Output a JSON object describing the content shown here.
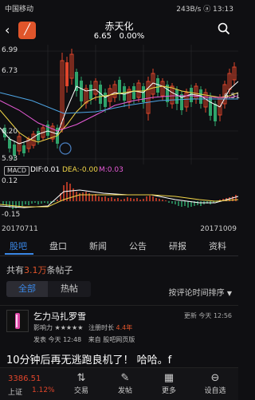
{
  "status": {
    "carrier": "中国移动",
    "right": "243B/s ⓐ 13:13"
  },
  "header": {
    "title": "赤天化",
    "price": "6.65",
    "change": "0.00%"
  },
  "chart_labels": {
    "y_top": "6.99",
    "y_mid1": "6.73",
    "y_mid2": "6.20",
    "y_low": "5.93",
    "last": "6.51"
  },
  "macd": {
    "label": "MACD",
    "dif": "DIF:0.01",
    "dea": "DEA:-0.00",
    "m": "M:0.03",
    "y_top": "0.12",
    "y_bot": "-0.15"
  },
  "dates": {
    "start": "20170711",
    "end": "20171009"
  },
  "tabs": [
    "股吧",
    "盘口",
    "新闻",
    "公告",
    "研报",
    "资料"
  ],
  "post_count": {
    "prefix": "共有",
    "num": "3.1万",
    "suffix": "条帖子"
  },
  "filters": {
    "all": "全部",
    "hot": "热帖",
    "sort": "按评论时间排序"
  },
  "post": {
    "user": "乞力马扎罗雪",
    "influence": "影响力 ★★★★★",
    "reg": "注册时长",
    "reg_val": "4.4年",
    "posted": "发表 今天 12:48",
    "source": "来自 股吧网页版",
    "update": "更新 今天 12:56",
    "text": "10分钟后再无逃跑良机了！ 哈哈。f"
  },
  "bottom": {
    "index_val": "3386.51",
    "index_name": "上证",
    "index_pct": "1.12%",
    "items": [
      "交易",
      "发帖",
      "更多",
      "设自选"
    ]
  }
}
